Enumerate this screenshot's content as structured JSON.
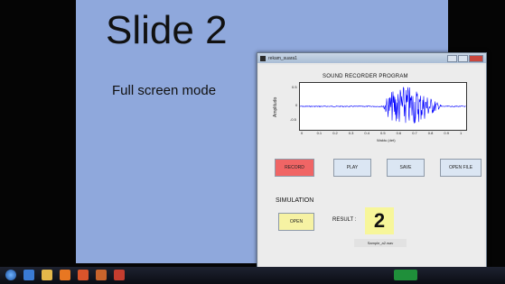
{
  "slide": {
    "title": "Slide 2",
    "subtitle": "Full screen mode"
  },
  "window": {
    "title": "rekam_suara1"
  },
  "app": {
    "program_title": "SOUND RECORDER PROGRAM",
    "plot": {
      "ylabel": "Amplitudo",
      "xlabel": "Waktu (det)",
      "yticks": [
        "0.5",
        "0",
        "-0.5"
      ],
      "xticks": [
        "0",
        "0.1",
        "0.2",
        "0.3",
        "0.4",
        "0.5",
        "0.6",
        "0.7",
        "0.8",
        "0.9",
        "1"
      ],
      "xlim": [
        0,
        1
      ],
      "ylim": [
        -1,
        1
      ]
    },
    "buttons": {
      "record": "RECORD",
      "play": "PLAY",
      "save": "SAVE",
      "open_file": "OPEN FILE"
    },
    "simulation": {
      "label": "SIMULATION",
      "open_button": "OPEN",
      "result_label": "RESULT :",
      "result_value": "2",
      "file_name": "Sample_a2.wav"
    },
    "colors": {
      "record_button": "#f06565",
      "result_box": "#f7f69a",
      "waveform": "#0000ff"
    }
  },
  "taskbar": {
    "icons": [
      "start-icon",
      "ie-icon",
      "explorer-icon",
      "media-icon",
      "firefox-icon",
      "matlab-icon",
      "powerpoint-icon"
    ]
  }
}
